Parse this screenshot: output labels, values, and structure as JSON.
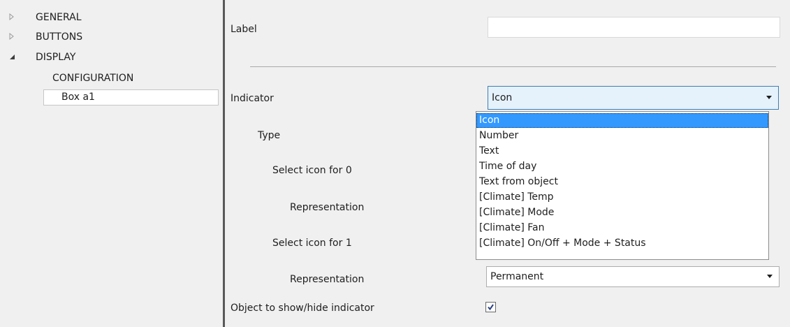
{
  "tree": {
    "items": [
      {
        "label": "GENERAL",
        "expander": "collapsed-triangle-icon"
      },
      {
        "label": "BUTTONS",
        "expander": "collapsed-triangle-icon"
      },
      {
        "label": "DISPLAY",
        "expander": "expanded-triangle-icon"
      },
      {
        "label": "CONFIGURATION"
      },
      {
        "label": "Box a1",
        "selected": true
      }
    ]
  },
  "form": {
    "label": {
      "caption": "Label",
      "value": ""
    },
    "indicator": {
      "caption": "Indicator",
      "value": "Icon"
    },
    "type": {
      "caption": "Type"
    },
    "select_icon_0": {
      "caption": "Select icon for 0"
    },
    "representation_0": {
      "caption": "Representation"
    },
    "select_icon_1": {
      "caption": "Select icon for 1"
    },
    "representation_1": {
      "caption": "Representation",
      "value": "Permanent"
    },
    "object_show_hide": {
      "caption": "Object to show/hide indicator",
      "checked": true
    }
  },
  "dropdown": {
    "options": [
      "Icon",
      "Number",
      "Text",
      "Time of day",
      "Text from object",
      "[Climate] Temp",
      "[Climate] Mode",
      "[Climate] Fan",
      "[Climate] On/Off + Mode + Status"
    ],
    "selected": "Icon"
  },
  "colors": {
    "selection": "#3399ff",
    "focus_border": "#3c7fb1",
    "panel_bg": "#f0f0f0",
    "splitter": "#595959"
  }
}
